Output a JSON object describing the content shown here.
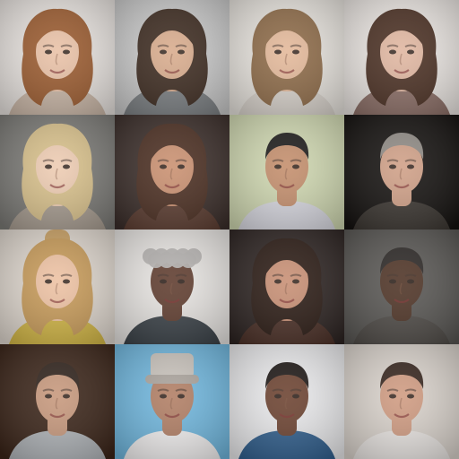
{
  "grid": {
    "rows": 4,
    "columns": 4,
    "tiles": [
      {
        "subject": "portrait-face",
        "hair": "auburn-long",
        "bg": "#e9e4e0",
        "hair_color": "#9a5a2e",
        "skin": "#e9c1a6",
        "shirt": "#c9b6a6"
      },
      {
        "subject": "portrait-face",
        "hair": "dark-brown-long",
        "bg": "#c9c9c9",
        "hair_color": "#3c2a1f",
        "skin": "#d8ab8c",
        "shirt": "#7b7f82"
      },
      {
        "subject": "portrait-face",
        "hair": "light-brown-long",
        "bg": "#e8e4de",
        "hair_color": "#8d6a47",
        "skin": "#e3b899",
        "shirt": "#d9d3cc"
      },
      {
        "subject": "portrait-face",
        "hair": "dark-brown-long",
        "bg": "#ece7e3",
        "hair_color": "#4a2f22",
        "skin": "#e0b6a0",
        "shirt": "#8c6f67"
      },
      {
        "subject": "portrait-face",
        "hair": "blonde-long",
        "bg": "#7b7a76",
        "hair_color": "#d8c08a",
        "skin": "#edcbb1",
        "shirt": "#a69b8f"
      },
      {
        "subject": "portrait-face",
        "hair": "dark-brown-long",
        "bg": "#3b2e2a",
        "hair_color": "#4a2d20",
        "skin": "#c98f6f",
        "shirt": "#5b3c30"
      },
      {
        "subject": "portrait-face",
        "hair": "black-short",
        "bg": "#cfd7b0",
        "hair_color": "#1c1a19",
        "skin": "#c38d6b",
        "shirt": "#d6d6de"
      },
      {
        "subject": "portrait-face",
        "hair": "grey-bald",
        "bg": "#14110f",
        "hair_color": "#8f8a84",
        "skin": "#cf9f86",
        "shirt": "#3a3530"
      },
      {
        "subject": "portrait-face",
        "hair": "blonde-updo",
        "bg": "#dfd7ce",
        "hair_color": "#c79a58",
        "skin": "#edc1a2",
        "shirt": "#d1b544"
      },
      {
        "subject": "portrait-face",
        "hair": "grey-curly",
        "bg": "#e7e4e1",
        "hair_color": "#b3b0ae",
        "skin": "#5e3b2d",
        "shirt": "#394046"
      },
      {
        "subject": "portrait-face",
        "hair": "dark-brown-long",
        "bg": "#2d2422",
        "hair_color": "#2a1a13",
        "skin": "#c78e73",
        "shirt": "#4a2f26"
      },
      {
        "subject": "portrait-face",
        "hair": "black-short",
        "bg": "#585653",
        "hair_color": "#2a2624",
        "skin": "#4d3224",
        "shirt": "#4e4a46"
      },
      {
        "subject": "portrait-face",
        "hair": "dark-brown-short",
        "bg": "#3a2418",
        "hair_color": "#2e211a",
        "skin": "#c6977b",
        "shirt": "#aeb2b6"
      },
      {
        "subject": "portrait-face",
        "hair": "hat",
        "bg": "#6fb6dd",
        "hair_color": "#c9c3bc",
        "skin": "#b07d63",
        "shirt": "#f0eeee"
      },
      {
        "subject": "portrait-face",
        "hair": "black-short",
        "bg": "#e9e9eb",
        "hair_color": "#1c1614",
        "skin": "#6b412f",
        "shirt": "#2f5d8b"
      },
      {
        "subject": "portrait-face",
        "hair": "dark-brown-short",
        "bg": "#d9d2cb",
        "hair_color": "#35241c",
        "skin": "#cf9a80",
        "shirt": "#e7e3e0"
      }
    ]
  }
}
